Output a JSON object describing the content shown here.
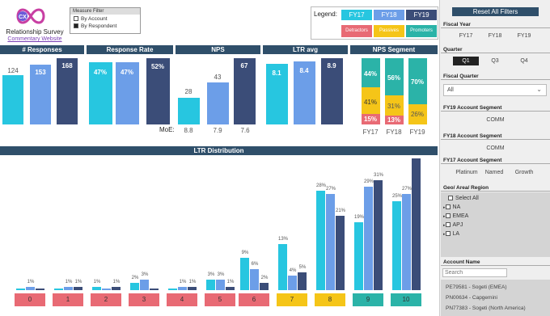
{
  "logo": {
    "title": "Relationship Survey",
    "link": "Commentary Website"
  },
  "measure_filter": {
    "title": "Measure Filter",
    "options": [
      "By Account",
      "By Respondent"
    ],
    "selected": "By Respondent"
  },
  "legend": {
    "label": "Legend:",
    "years": [
      "FY17",
      "FY18",
      "FY19"
    ],
    "segments": [
      "Detractors",
      "Passives",
      "Promoters"
    ]
  },
  "colors": {
    "fy17": "#27c6e0",
    "fy18": "#6c9ee8",
    "fy19": "#3b4d78",
    "nps": "#e86a74",
    "detractor": "#e86a74",
    "passive": "#f5c518",
    "promoter": "#2bb3a8",
    "header": "#2f4f6a"
  },
  "sections": {
    "responses": "# Responses",
    "response_rate": "Response Rate",
    "nps": "NPS",
    "ltr_avg": "LTR avg",
    "nps_segment": "NPS Segment",
    "ltr_distribution": "LTR Distribution"
  },
  "responses": [
    "124",
    "153",
    "168"
  ],
  "response_rate": [
    "47%",
    "47%",
    "52%"
  ],
  "nps": {
    "values": [
      "28",
      "43",
      "67"
    ],
    "moe_label": "MoE:",
    "moe": [
      "8.8",
      "7.9",
      "7.6"
    ]
  },
  "ltr_avg": [
    "8.1",
    "8.4",
    "8.9"
  ],
  "nps_segment": {
    "years": [
      "FY17",
      "FY18",
      "FY19"
    ],
    "detractors": [
      "15%",
      "13%",
      ""
    ],
    "passives": [
      "41%",
      "31%",
      "26%"
    ],
    "promoters": [
      "44%",
      "56%",
      "70%"
    ]
  },
  "ltr_distribution": {
    "categories": [
      "0",
      "1",
      "2",
      "3",
      "4",
      "5",
      "6",
      "7",
      "8",
      "9",
      "10"
    ],
    "fy17": [
      "",
      "",
      "1%",
      "2%",
      "",
      "3%",
      "9%",
      "13%",
      "28%",
      "19%",
      "25%"
    ],
    "fy18": [
      "1%",
      "1%",
      "",
      "3%",
      "1%",
      "3%",
      "6%",
      "4%",
      "27%",
      "29%",
      "27%"
    ],
    "fy19": [
      "",
      "1%",
      "1%",
      "",
      "1%",
      "1%",
      "2%",
      "5%",
      "21%",
      "31%",
      ""
    ]
  },
  "right_panel": {
    "reset": "Reset All Filters",
    "fiscal_year": {
      "title": "Fiscal Year",
      "options": [
        "FY17",
        "FY18",
        "FY19"
      ]
    },
    "quarter": {
      "title": "Quarter",
      "options": [
        "Q1",
        "Q3",
        "Q4"
      ],
      "selected": "Q1"
    },
    "fiscal_quarter": {
      "title": "Fiscal Quarter",
      "value": "All"
    },
    "fy19_segment": {
      "title": "FY19 Account Segment",
      "value": "COMM"
    },
    "fy18_segment": {
      "title": "FY18 Account Segment",
      "value": "COMM"
    },
    "fy17_segment": {
      "title": "FY17 Account Segment",
      "options": [
        "Platinum",
        "Named",
        "Growth"
      ]
    },
    "geo": {
      "title": "Geo/ Area/ Region",
      "items": [
        "Select All",
        "NA",
        "EMEA",
        "APJ",
        "LA"
      ]
    },
    "account_name": {
      "title": "Account Name",
      "search_placeholder": "Search",
      "items": [
        "PE79581 - Sogeti (EMEA)",
        "PN00634 - Capgemini",
        "PN77383 - Sogeti (North America)"
      ]
    }
  }
}
